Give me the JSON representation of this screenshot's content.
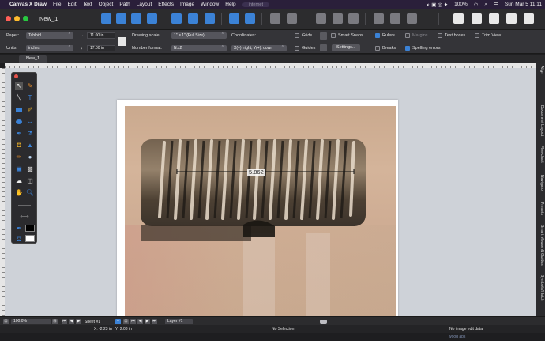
{
  "menubar": {
    "app_name": "Canvas X Draw",
    "items": [
      "File",
      "Edit",
      "Text",
      "Object",
      "Path",
      "Layout",
      "Effects",
      "Image",
      "Window",
      "Help"
    ],
    "url_hint": "internet",
    "battery": "100%",
    "clock": "Sun Mar 5  11:11"
  },
  "window": {
    "title": "New_1",
    "traffic_colors": [
      "#ff5f57",
      "#febc2e",
      "#28c840"
    ]
  },
  "options": {
    "paper_label": "Paper:",
    "paper_value": "Tabloid",
    "units_label": "Units:",
    "units_value": "inches",
    "width_value": "11.00 in",
    "height_value": "17.00 in",
    "drawing_scale_label": "Drawing scale:",
    "drawing_scale_value": "1\" = 1\"  (Full Size)",
    "number_format_label": "Number format:",
    "number_format_value": "N.x2",
    "coordinates_label": "Coordinates:",
    "coordinates_value": "X(+): right, Y(+): down",
    "grids_label": "Grids",
    "guides_label": "Guides",
    "smart_snaps_label": "Smart Snaps",
    "settings_label": "Settings...",
    "rulers_label": "Rulers",
    "breaks_label": "Breaks",
    "margins_label": "Margins",
    "spelling_label": "Spelling errors",
    "textboxes_label": "Text boxes",
    "trimview_label": "Trim View"
  },
  "tabs": {
    "doc_tab": "New_1"
  },
  "canvas": {
    "measure_value": "5.862"
  },
  "sidetabs": [
    "Align",
    "Document Layout",
    "Flowchart",
    "Navigator",
    "Presets",
    "Smart Mouse & Guides",
    "Symbols/Hatch"
  ],
  "status": {
    "zoom": "100.0%",
    "sheet": "Sheet #1",
    "layer": "Layer #1",
    "coords_x": "X: -2.23 in",
    "coords_y": "Y: 2.08 in",
    "selection": "No Selection",
    "image_info": "No image edit data",
    "extra": "wood abs"
  },
  "colors": {
    "accent": "#3b82d6"
  }
}
